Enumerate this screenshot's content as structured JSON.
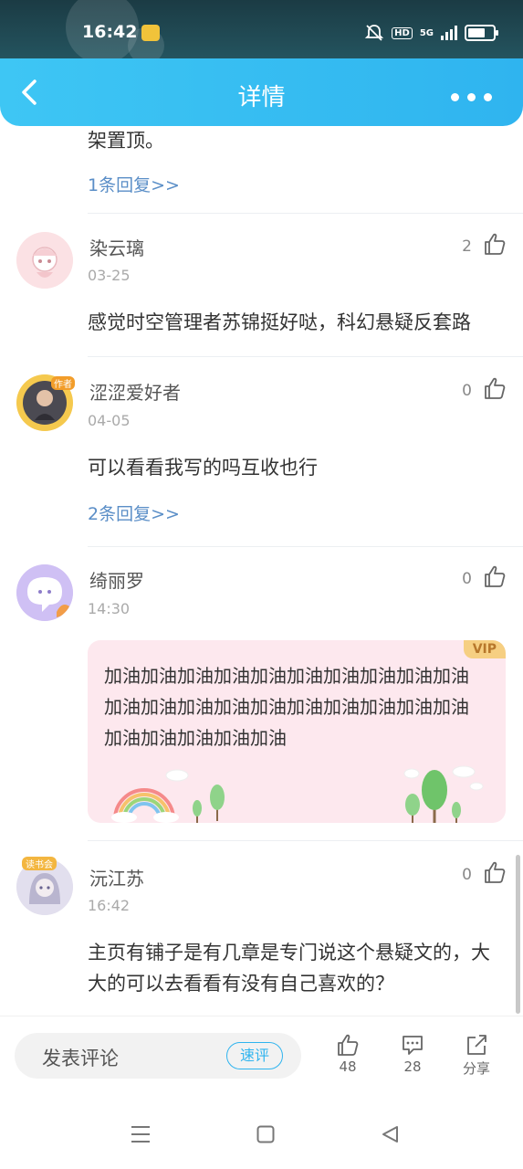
{
  "status": {
    "time": "16:42",
    "network": "5G"
  },
  "header": {
    "title": "详情"
  },
  "top_fragment": {
    "text": "架置顶。",
    "replies": "1条回复>>"
  },
  "comments": [
    {
      "name": "染云璃",
      "date": "03-25",
      "likes": "2",
      "text": "感觉时空管理者苏锦挺好哒，科幻悬疑反套路"
    },
    {
      "name": "涩涩爱好者",
      "date": "04-05",
      "likes": "0",
      "text": "可以看看我写的吗互收也行",
      "replies": "2条回复>>",
      "badge": "作者"
    },
    {
      "name": "绮丽罗",
      "date": "14:30",
      "likes": "0",
      "vip_label": "VIP",
      "text": "加油加油加油加油加油加油加油加油加油加油加油加油加油加油加油加油加油加油加油加油加油加油加油加油加油"
    },
    {
      "name": "沅江苏",
      "date": "16:42",
      "likes": "0",
      "badge": "读书会",
      "text": "主页有铺子是有几章是专门说这个悬疑文的，大大的可以去看看有没有自己喜欢的？"
    }
  ],
  "bottom": {
    "input_placeholder": "发表评论",
    "quick_label": "速评",
    "like_count": "48",
    "comment_count": "28",
    "share_label": "分享"
  },
  "colors": {
    "accent": "#2fb4ef",
    "link": "#5a8ec7",
    "vip_bg": "#fde8ee"
  }
}
